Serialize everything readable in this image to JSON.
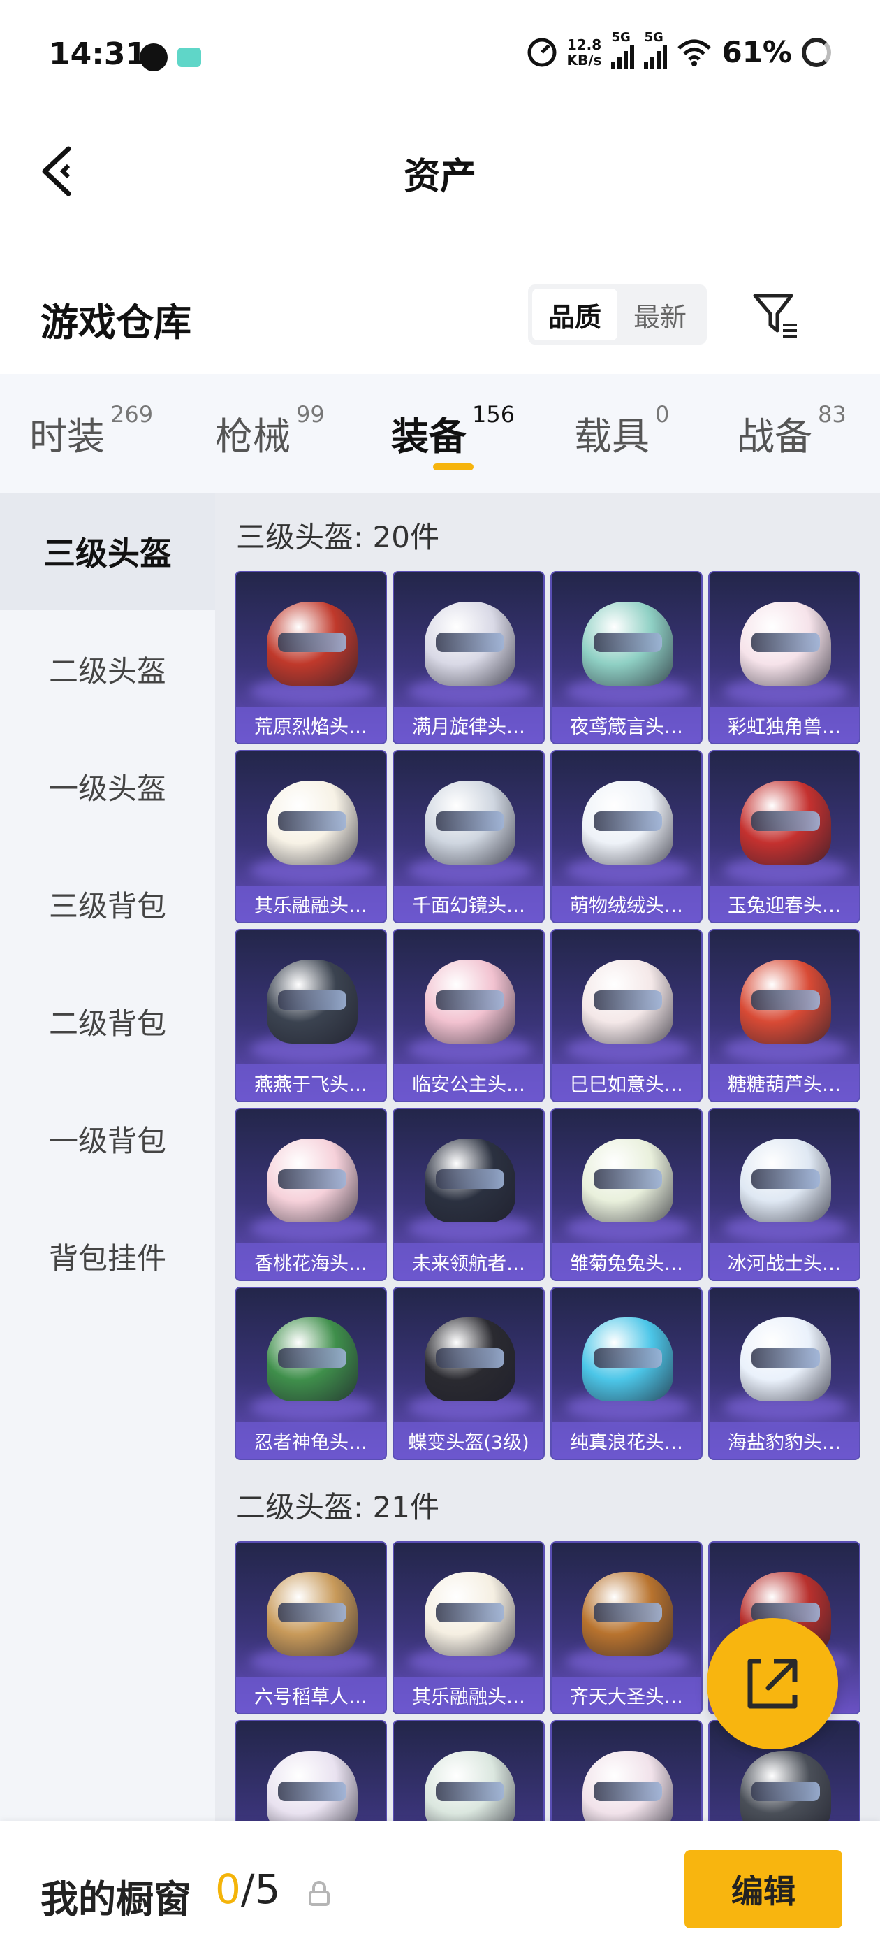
{
  "status": {
    "time": "14:31",
    "speed_value": "12.8",
    "speed_unit": "KB/s",
    "net1": "5G",
    "net2": "5G",
    "battery": "61%"
  },
  "header": {
    "title": "资产"
  },
  "warehouse": {
    "title": "游戏仓库",
    "sort_options": [
      "品质",
      "最新"
    ],
    "sort_active": "品质"
  },
  "tabs": [
    {
      "label": "时装",
      "count": "269"
    },
    {
      "label": "枪械",
      "count": "99"
    },
    {
      "label": "装备",
      "count": "156"
    },
    {
      "label": "载具",
      "count": "0"
    },
    {
      "label": "战备",
      "count": "83"
    }
  ],
  "active_tab": "装备",
  "sidebar": {
    "items": [
      "三级头盔",
      "二级头盔",
      "一级头盔",
      "三级背包",
      "二级背包",
      "一级背包",
      "背包挂件"
    ],
    "active": "三级头盔"
  },
  "sections": [
    {
      "title": "三级头盔: 20件",
      "items": [
        {
          "name": "荒原烈焰头…",
          "color": "#c0392b"
        },
        {
          "name": "满月旋律头…",
          "color": "#d9d9e6"
        },
        {
          "name": "夜鸢箴言头…",
          "color": "#8fd0c4"
        },
        {
          "name": "彩虹独角兽…",
          "color": "#f6e3ea"
        },
        {
          "name": "其乐融融头…",
          "color": "#f7f2e6"
        },
        {
          "name": "千面幻镜头…",
          "color": "#cfd6e0"
        },
        {
          "name": "萌物绒绒头…",
          "color": "#eef2f8"
        },
        {
          "name": "玉兔迎春头…",
          "color": "#c4312f"
        },
        {
          "name": "燕燕于飞头…",
          "color": "#3b4350"
        },
        {
          "name": "临安公主头…",
          "color": "#f2c2d0"
        },
        {
          "name": "巳巳如意头…",
          "color": "#f4e8e8"
        },
        {
          "name": "糖糖葫芦头…",
          "color": "#d84a35"
        },
        {
          "name": "香桃花海头…",
          "color": "#f6d1da"
        },
        {
          "name": "未来领航者…",
          "color": "#2b3140"
        },
        {
          "name": "雏菊兔兔头…",
          "color": "#e9f0dc"
        },
        {
          "name": "冰河战士头…",
          "color": "#dfe8f3"
        },
        {
          "name": "忍者神龟头…",
          "color": "#3f8f4b"
        },
        {
          "name": "蝶变头盔(3级)",
          "color": "#2a2a30"
        },
        {
          "name": "纯真浪花头…",
          "color": "#4cc6e8"
        },
        {
          "name": "海盐豹豹头…",
          "color": "#eaf1fb"
        }
      ]
    },
    {
      "title": "二级头盔: 21件",
      "items": [
        {
          "name": "六号稻草人…",
          "color": "#c89a5a"
        },
        {
          "name": "其乐融融头…",
          "color": "#f5efe2"
        },
        {
          "name": "齐天大圣头…",
          "color": "#b8732e"
        },
        {
          "name": "",
          "color": "#b8302d"
        },
        {
          "name": "",
          "color": "#e9e2f0"
        },
        {
          "name": "",
          "color": "#dbe7df"
        },
        {
          "name": "",
          "color": "#f1e2ea"
        },
        {
          "name": "",
          "color": "#4a4f58"
        }
      ]
    }
  ],
  "bottom": {
    "showcase_label": "我的橱窗",
    "current": "0",
    "total": "/5",
    "edit_label": "编辑"
  },
  "colors": {
    "accent": "#f8b50f",
    "card_bg": "#3a3478"
  }
}
